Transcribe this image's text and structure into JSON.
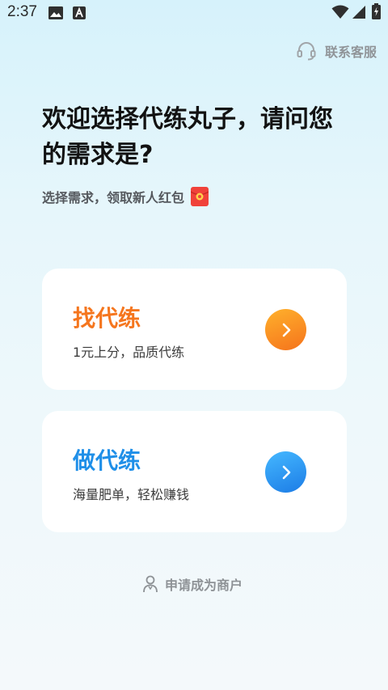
{
  "status_bar": {
    "time": "2:37",
    "icons": [
      "gallery-icon",
      "app-a-icon",
      "wifi-icon",
      "cellular-signal-icon",
      "battery-charging-icon"
    ]
  },
  "header": {
    "support_label": "联系客服",
    "support_icon": "headset-icon"
  },
  "welcome": {
    "headline": "欢迎选择代练丸子，请问您的需求是?",
    "subtitle": "选择需求，领取新人红包",
    "subtitle_icon": "red-packet-icon"
  },
  "options": [
    {
      "title": "找代练",
      "subtitle": "1元上分，品质代练",
      "title_color": "#f5761e",
      "button_gradient": [
        "#ffb12c",
        "#f5731c"
      ],
      "icon": "chevron-right-icon"
    },
    {
      "title": "做代练",
      "subtitle": "海量肥单，轻松赚钱",
      "title_color": "#1f8fe8",
      "button_gradient": [
        "#45b8ff",
        "#1c7ce6"
      ],
      "icon": "chevron-right-icon"
    }
  ],
  "footer": {
    "merchant_label": "申请成为商户",
    "merchant_icon": "person-icon"
  }
}
